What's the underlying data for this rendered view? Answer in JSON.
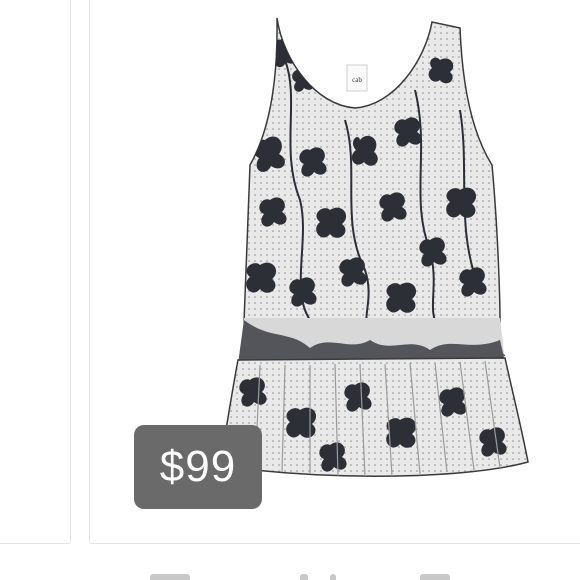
{
  "listing": {
    "price": "$99",
    "badge_color": "#6a6a6a",
    "icon": "floral-sleeveless-peplum-top-image"
  }
}
